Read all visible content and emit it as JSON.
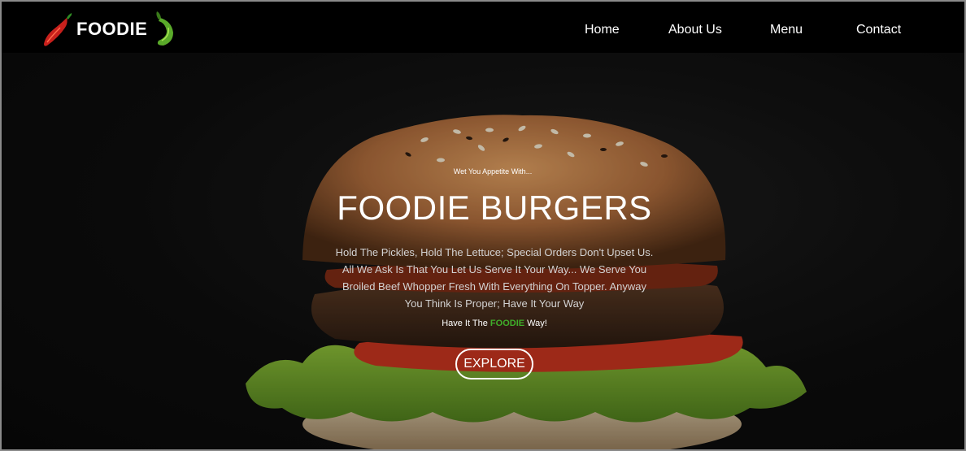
{
  "brand": {
    "name": "FOODIE",
    "accent_green": "#3fae2a",
    "chili_red": "#c8201c"
  },
  "nav": {
    "items": [
      {
        "label": "Home"
      },
      {
        "label": "About Us"
      },
      {
        "label": "Menu"
      },
      {
        "label": "Contact"
      }
    ]
  },
  "hero": {
    "tagline": "Wet You Appetite With...",
    "title": "FOODIE BURGERS",
    "description": "Hold The Pickles, Hold The Lettuce; Special Orders Don't Upset Us. All We Ask Is That You Let Us Serve It Your Way... We Serve You Broiled Beef Whopper Fresh With Everything On Topper. Anyway You Think Is Proper; Have It Your Way",
    "have_it_prefix": "Have It The",
    "have_it_brand": "FOODIE",
    "have_it_suffix": "Way!",
    "button_label": "EXPLORE"
  },
  "icons": {
    "left_logo_icon": "red-chili-icon",
    "right_logo_icon": "green-chili-icon"
  }
}
